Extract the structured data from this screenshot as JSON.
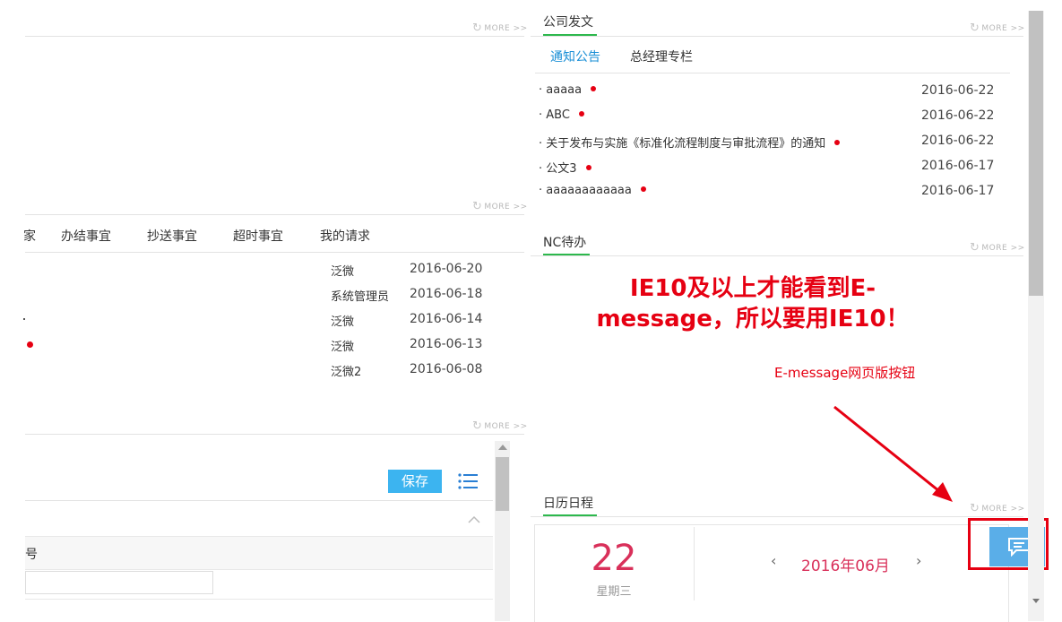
{
  "more_label": "MORE",
  "left": {
    "tabs": [
      "办结事宜",
      "抄送事宜",
      "超时事宜",
      "我的请求"
    ],
    "tab_fragment": "家",
    "rows": [
      {
        "person": "泛微",
        "date": "2016-06-20"
      },
      {
        "person": "系统管理员",
        "date": "2016-06-18"
      },
      {
        "person": "泛微",
        "date": "2016-06-14"
      },
      {
        "person": "泛微",
        "date": "2016-06-13"
      },
      {
        "person": "泛微2",
        "date": "2016-06-08"
      }
    ],
    "save_label": "保存",
    "field_fragment": "号"
  },
  "docs": {
    "title": "公司发文",
    "tabs": [
      "通知公告",
      "总经理专栏"
    ],
    "items": [
      {
        "title": "aaaaa",
        "date": "2016-06-22"
      },
      {
        "title": "ABC",
        "date": "2016-06-22"
      },
      {
        "title": "关于发布与实施《标准化流程制度与审批流程》的通知",
        "date": "2016-06-22"
      },
      {
        "title": "公文3",
        "date": "2016-06-17"
      },
      {
        "title": "aaaaaaaaaaaa",
        "date": "2016-06-17"
      }
    ]
  },
  "nc": {
    "title": "NC待办",
    "notice_line1": "IE10及以上才能看到E-",
    "notice_line2": "message，所以要用IE10！",
    "annotation": "E-message网页版按钮"
  },
  "calendar": {
    "title": "日历日程",
    "day": "22",
    "weekday": "星期三",
    "month": "2016年06月"
  },
  "colors": {
    "accent_green": "#2db84d",
    "accent_blue": "#1a8fd6",
    "save_button": "#3cb4f0",
    "annotation_red": "#e60012",
    "calendar_red": "#d9305a",
    "emessage_button": "#5aaee8"
  }
}
